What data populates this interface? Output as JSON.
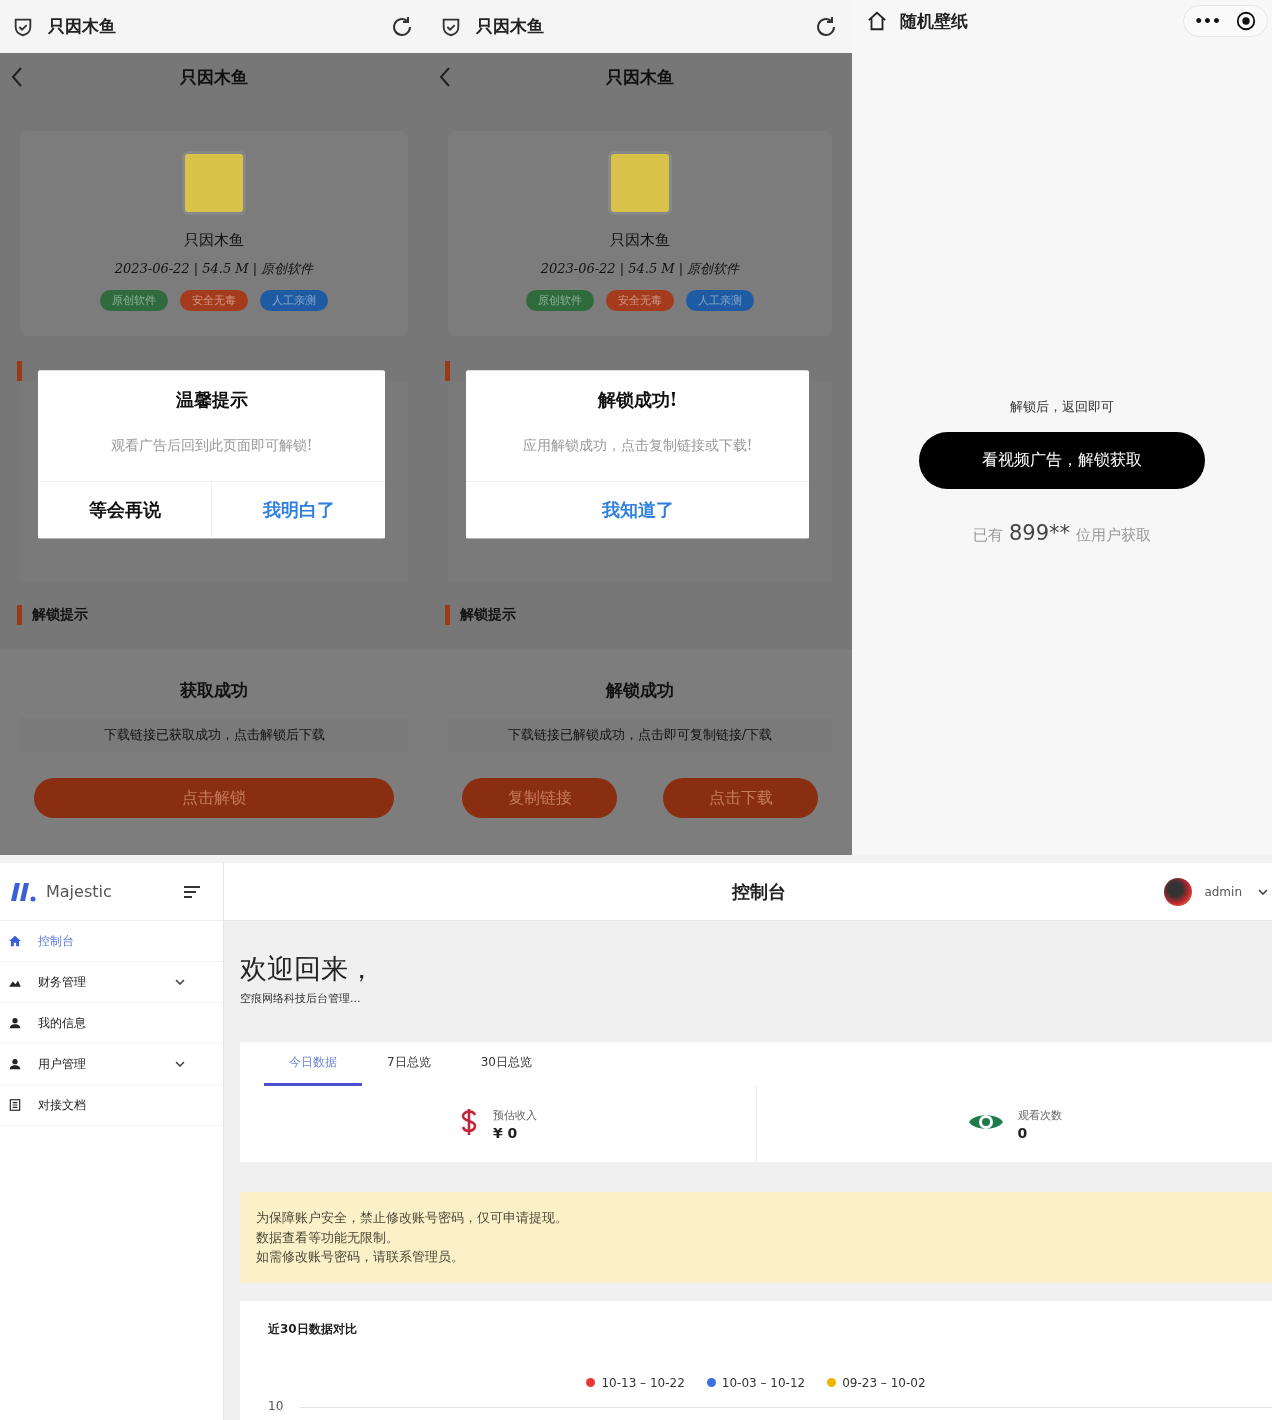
{
  "phones": [
    {
      "top_bar_title": "只因木鱼",
      "page_title": "只因木鱼",
      "app": {
        "name": "只因木鱼",
        "meta": "2023-06-22 | 54.5 M | 原创软件",
        "tags": [
          {
            "label": "原创软件",
            "color": "#2f6b3d"
          },
          {
            "label": "安全无毒",
            "color": "#a53b1d"
          },
          {
            "label": "人工亲测",
            "color": "#1f5ba3"
          }
        ]
      },
      "dialog": {
        "title": "温馨提示",
        "message": "观看广告后回到此页面即可解锁!",
        "buttons": [
          {
            "label": "等会再说",
            "primary": false
          },
          {
            "label": "我明白了",
            "primary": true
          }
        ]
      },
      "section_title": "解锁提示",
      "result": {
        "title": "获取成功",
        "message": "下载链接已获取成功，点击解锁后下载",
        "buttons": [
          "点击解锁"
        ]
      }
    },
    {
      "top_bar_title": "只因木鱼",
      "page_title": "只因木鱼",
      "app": {
        "name": "只因木鱼",
        "meta": "2023-06-22 | 54.5 M | 原创软件",
        "tags": [
          {
            "label": "原创软件",
            "color": "#2f6b3d"
          },
          {
            "label": "安全无毒",
            "color": "#a53b1d"
          },
          {
            "label": "人工亲测",
            "color": "#1f5ba3"
          }
        ]
      },
      "dialog": {
        "title": "解锁成功!",
        "message": "应用解锁成功，点击复制链接或下载!",
        "buttons": [
          {
            "label": "我知道了",
            "primary": true
          }
        ]
      },
      "section_title": "解锁提示",
      "result": {
        "title": "解锁成功",
        "message": "下载链接已解锁成功，点击即可复制链接/下载",
        "buttons": [
          "复制链接",
          "点击下载"
        ]
      }
    }
  ],
  "wallpaper": {
    "title": "随机壁纸",
    "more": "•••",
    "hint": "解锁后，返回即可",
    "button": "看视频广告，解锁获取",
    "count_prefix": "已有",
    "count": "899**",
    "count_suffix": "位用户获取"
  },
  "dashboard": {
    "brand": "Majestic",
    "header_title": "控制台",
    "user": "admin",
    "sidebar": {
      "items": [
        {
          "label": "控制台",
          "kind": "home",
          "selected": true,
          "has_submenu": false
        },
        {
          "label": "财务管理",
          "kind": "finance",
          "selected": false,
          "has_submenu": true
        },
        {
          "label": "我的信息",
          "kind": "person",
          "selected": false,
          "has_submenu": false
        },
        {
          "label": "用户管理",
          "kind": "person",
          "selected": false,
          "has_submenu": true
        },
        {
          "label": "对接文档",
          "kind": "document",
          "selected": false,
          "has_submenu": false
        }
      ]
    },
    "welcome": "欢迎回来，",
    "subtitle": "空痕网络科技后台管理...",
    "tabs": [
      {
        "label": "今日数据",
        "selected": true
      },
      {
        "label": "7日总览",
        "selected": false
      },
      {
        "label": "30日总览",
        "selected": false
      }
    ],
    "stats": [
      {
        "kind": "money",
        "label": "预估收入",
        "value": "¥ 0"
      },
      {
        "kind": "views",
        "label": "观看次数",
        "value": "0"
      }
    ],
    "notice": [
      "为保障账户安全，禁止修改账号密码，仅可申请提现。",
      "数据查看等功能无限制。",
      "如需修改账号密码，请联系管理员。"
    ],
    "chart": {
      "title": "近30日数据对比",
      "legend": [
        {
          "label": "10-13 – 10-22",
          "color": "#e53935"
        },
        {
          "label": "10-03 – 10-12",
          "color": "#3b6fe0"
        },
        {
          "label": "09-23 – 10-02",
          "color": "#f0b400"
        }
      ],
      "y_tick": "10"
    }
  }
}
